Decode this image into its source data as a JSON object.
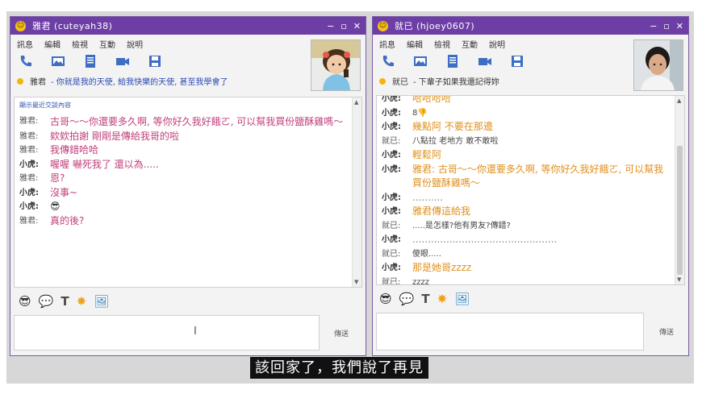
{
  "left_window": {
    "title": "雅君 (cuteyah38)",
    "window_controls": [
      "−",
      "▫",
      "✕"
    ],
    "menu": [
      "訊息",
      "編輯",
      "檢視",
      "互動",
      "說明"
    ],
    "tools": [
      "phone-icon",
      "image-icon",
      "file-icon",
      "video-icon",
      "save-icon"
    ],
    "status_name": "雅君",
    "status_msg": "- 你就是我的天使, 給我快樂的天使, 甚至我學會了",
    "recent_link": "顯示最近交談內容",
    "messages": [
      {
        "sender": "雅君:",
        "text": "古哥～～你還要多久啊, 等你好久我好餓ㄛ, 可以幫我買份鹽酥雞嗎～",
        "color": "pink"
      },
      {
        "sender": "雅君:",
        "text": "欸欸拍謝 剛剛是傳給我哥的啦",
        "color": "pink"
      },
      {
        "sender": "雅君:",
        "text": "我傳錯哈哈",
        "color": "pink"
      },
      {
        "sender": "小虎:",
        "text": "喔喔 嚇死我了 還以為.....",
        "color": "orange"
      },
      {
        "sender": "雅君:",
        "text": "恩?",
        "color": "pink"
      },
      {
        "sender": "小虎:",
        "text": "沒事~",
        "color": "orange"
      },
      {
        "sender": "小虎:",
        "text": "😎",
        "color": "orange"
      },
      {
        "sender": "雅君:",
        "text": "真的後?",
        "color": "pink"
      }
    ],
    "emotes": [
      "😎",
      "💬",
      "T",
      "✸",
      "🖼"
    ],
    "send_label": "傳送"
  },
  "right_window": {
    "title": "就已 (hjoey0607)",
    "window_controls": [
      "−",
      "▫",
      "✕"
    ],
    "menu": [
      "訊息",
      "編輯",
      "檢視",
      "互動",
      "說明"
    ],
    "tools": [
      "phone-icon",
      "image-icon",
      "file-icon",
      "video-icon",
      "save-icon"
    ],
    "status_name": "就已",
    "status_msg": "- 下輩子如果我還記得妳",
    "messages": [
      {
        "sender": "小虎:",
        "text": "哈哈哈哈",
        "color": "orange"
      },
      {
        "sender": "小虎:",
        "text": "8👎",
        "color": "dark"
      },
      {
        "sender": "小虎:",
        "text": "幾點阿 不要在那邊",
        "color": "orange"
      },
      {
        "sender": "就已:",
        "text": "八點拉 老地方 敢不敢啦",
        "color": "dark"
      },
      {
        "sender": "小虎:",
        "text": "輕鬆阿",
        "color": "orange"
      },
      {
        "sender": "小虎:",
        "text": "雅君: 古哥～～你還要多久啊, 等你好久我好餓ㄛ, 可以幫我買份鹽酥雞嗎～",
        "color": "orange"
      },
      {
        "sender": "小虎:",
        "text": "..........",
        "color": "gray"
      },
      {
        "sender": "小虎:",
        "text": "雅君傳這給我",
        "color": "orange"
      },
      {
        "sender": "就已:",
        "text": ".....是怎樣?他有男友?傳錯?",
        "color": "dark"
      },
      {
        "sender": "小虎:",
        "text": "...............................................",
        "color": "gray"
      },
      {
        "sender": "就已:",
        "text": "傻眼.....",
        "color": "dark"
      },
      {
        "sender": "小虎:",
        "text": "那是她哥zzzz",
        "color": "orange"
      },
      {
        "sender": "就已:",
        "text": "zzzz",
        "color": "dark"
      }
    ],
    "emotes": [
      "😎",
      "💬",
      "T",
      "✸",
      "🖼"
    ],
    "send_label": "傳送"
  },
  "subtitle": "該回家了，我們說了再見",
  "colors": {
    "titlebar": "#6d3fa6",
    "orange": "#e0901d",
    "pink": "#c2407c"
  }
}
